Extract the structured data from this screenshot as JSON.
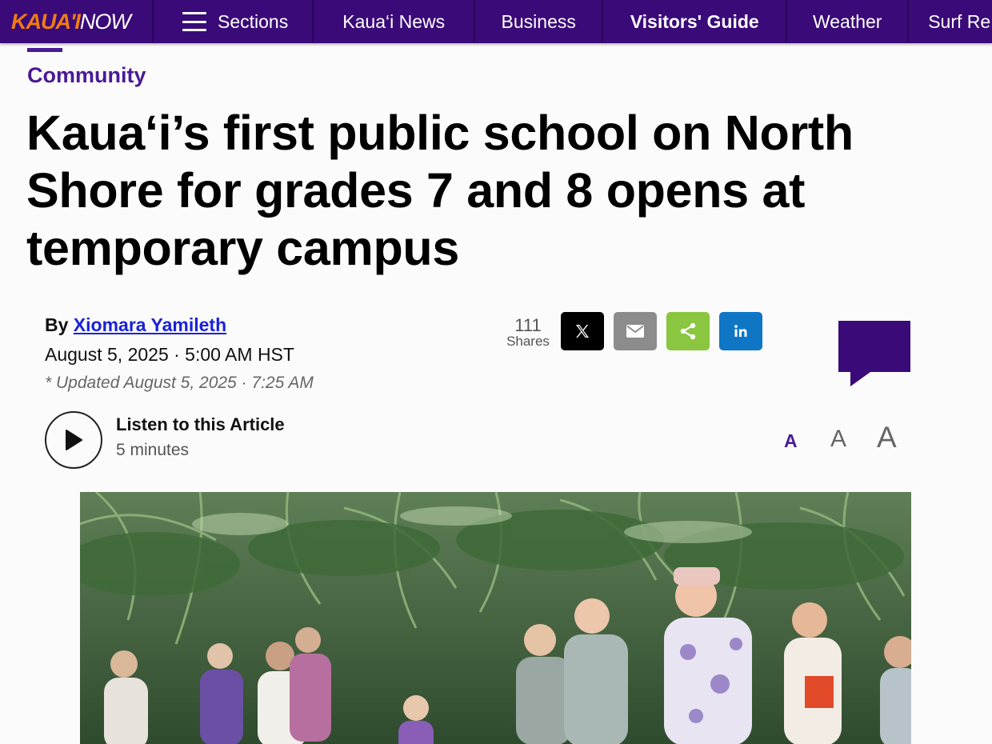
{
  "nav": {
    "logo_part1": "KAUA'I",
    "logo_part2": "NOW",
    "sections_label": "Sections",
    "items": [
      "Kaua‘i News",
      "Business",
      "Visitors' Guide",
      "Weather",
      "Surf Re"
    ]
  },
  "article": {
    "category": "Community",
    "headline": "Kaua‘i’s first public school on North Shore for grades 7 and 8 opens at temporary campus",
    "byline_prefix": "By",
    "author": "Xiomara Yamileth",
    "date": "August 5, 2025 · 5:00 AM HST",
    "updated": "* Updated August 5, 2025 · 7:25 AM"
  },
  "share": {
    "count": "111",
    "count_label": "Shares"
  },
  "listen": {
    "title": "Listen to this Article",
    "duration": "5 minutes"
  },
  "font_size_controls": [
    "A",
    "A",
    "A"
  ],
  "colors": {
    "nav_bg": "#3a0a78",
    "accent_purple": "#4a1a96",
    "logo_orange": "#f07c16",
    "link_blue": "#1a22d6",
    "x_bg": "#000000",
    "email_bg": "#8c8c8c",
    "share_bg": "#8ac640",
    "linkedin_bg": "#0e76c5"
  }
}
